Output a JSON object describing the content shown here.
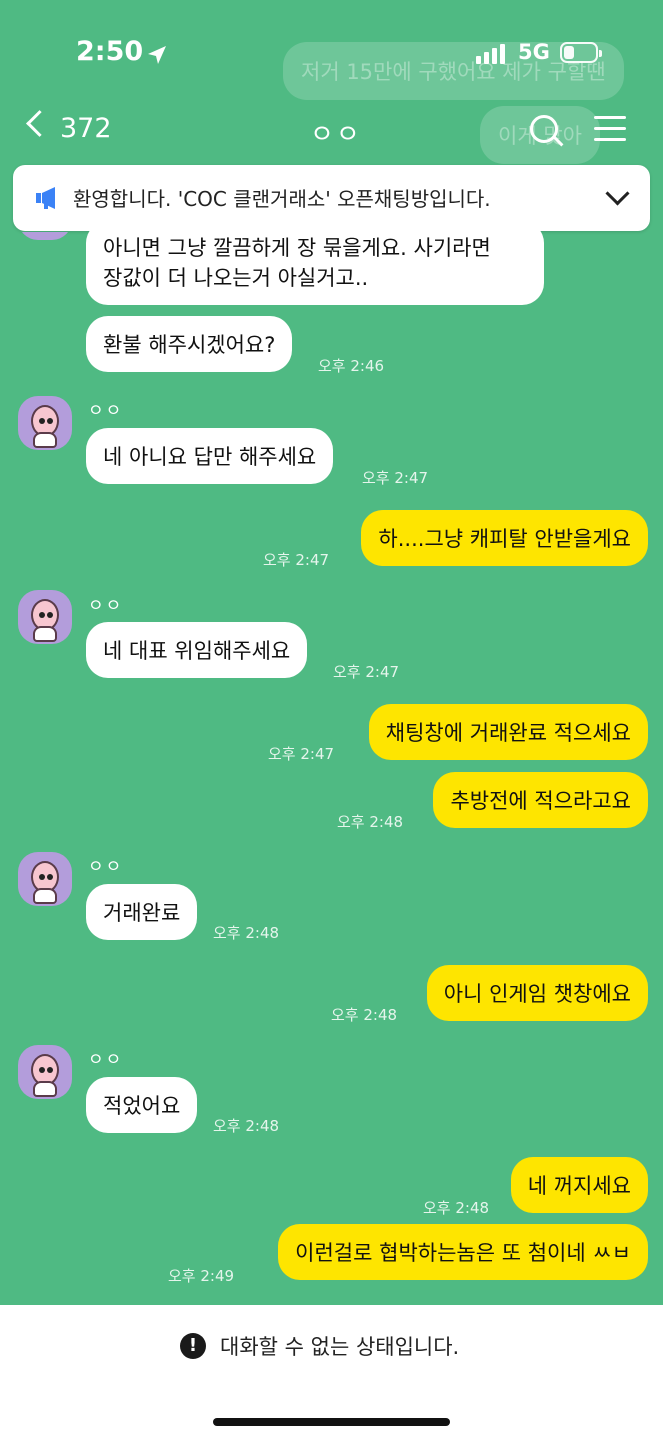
{
  "status_bar": {
    "time": "2:50",
    "carrier": "5G"
  },
  "background_bubbles": [
    "저거 15만에 구했어요 제가 구할땐",
    "이게 맞아"
  ],
  "header": {
    "member_count": "372",
    "room_name": "ㅇㅇ"
  },
  "notice": {
    "text": "환영합니다. 'COC 클랜거래소' 오픈채팅방입니다."
  },
  "messages": [
    {
      "side": "in",
      "lines": [
        "아니면 그냥 깔끔하게 장 묶을게요. 사기라면",
        "장값이 더 나오는거 아실거고.."
      ]
    },
    {
      "side": "in",
      "text": "환불 해주시겠어요?",
      "time": "오후 2:46"
    },
    {
      "side": "in",
      "sender": "ㅇㅇ",
      "text": "네 아니요 답만 해주세요",
      "time": "오후 2:47"
    },
    {
      "side": "out",
      "text": "하....그냥 캐피탈 안받을게요",
      "time": "오후 2:47"
    },
    {
      "side": "in",
      "sender": "ㅇㅇ",
      "text": "네 대표 위임해주세요",
      "time": "오후 2:47"
    },
    {
      "side": "out",
      "text": "채팅창에 거래완료 적으세요",
      "time": "오후 2:47"
    },
    {
      "side": "out",
      "text": "추방전에 적으라고요",
      "time": "오후 2:48"
    },
    {
      "side": "in",
      "sender": "ㅇㅇ",
      "text": "거래완료",
      "time": "오후 2:48"
    },
    {
      "side": "out",
      "text": "아니 인게임 챗창에요",
      "time": "오후 2:48"
    },
    {
      "side": "in",
      "sender": "ㅇㅇ",
      "text": "적었어요",
      "time": "오후 2:48"
    },
    {
      "side": "out",
      "text": "네 꺼지세요",
      "time": "오후 2:48"
    },
    {
      "side": "out",
      "text": "이런걸로 협박하는놈은 또 첨이네 ㅆㅂ",
      "time": "오후 2:49"
    }
  ],
  "bottom": {
    "disabled_text": "대화할 수 없는 상태입니다."
  },
  "colors": {
    "background": "#4fba83",
    "outgoing": "#fee500",
    "incoming": "#ffffff"
  }
}
